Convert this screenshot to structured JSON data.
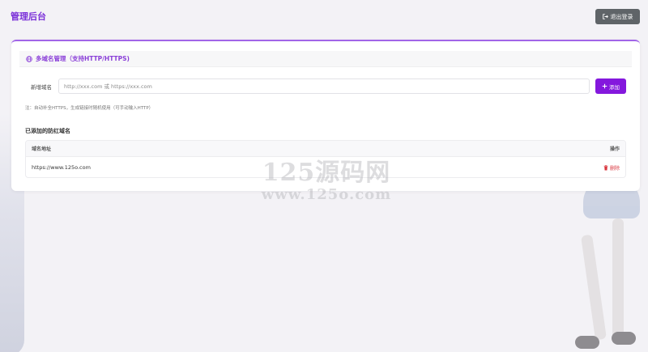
{
  "header": {
    "title": "管理后台",
    "logout_label": "退出登录"
  },
  "panel": {
    "title": "多域名管理（支持HTTP/HTTPS)",
    "form": {
      "label": "新增域名",
      "input_value": "",
      "input_placeholder": "http://xxx.com 或 https://xxx.com",
      "add_label": "添加"
    },
    "note": "注：自动补全HTTPS，生成链接时随机使用（可手动输入HTTP）",
    "list_title": "已添加的防红域名",
    "table": {
      "columns": [
        "域名地址",
        "操作"
      ],
      "rows": [
        {
          "domain": "https://www.125o.com",
          "action": "删除"
        }
      ]
    }
  },
  "watermark": {
    "line1": "125源码网",
    "line2": "www.125o.com"
  },
  "colors": {
    "accent": "#8418dd",
    "title": "#7a2fd8",
    "danger": "#d9363e",
    "logout_bg": "#5f6468"
  }
}
